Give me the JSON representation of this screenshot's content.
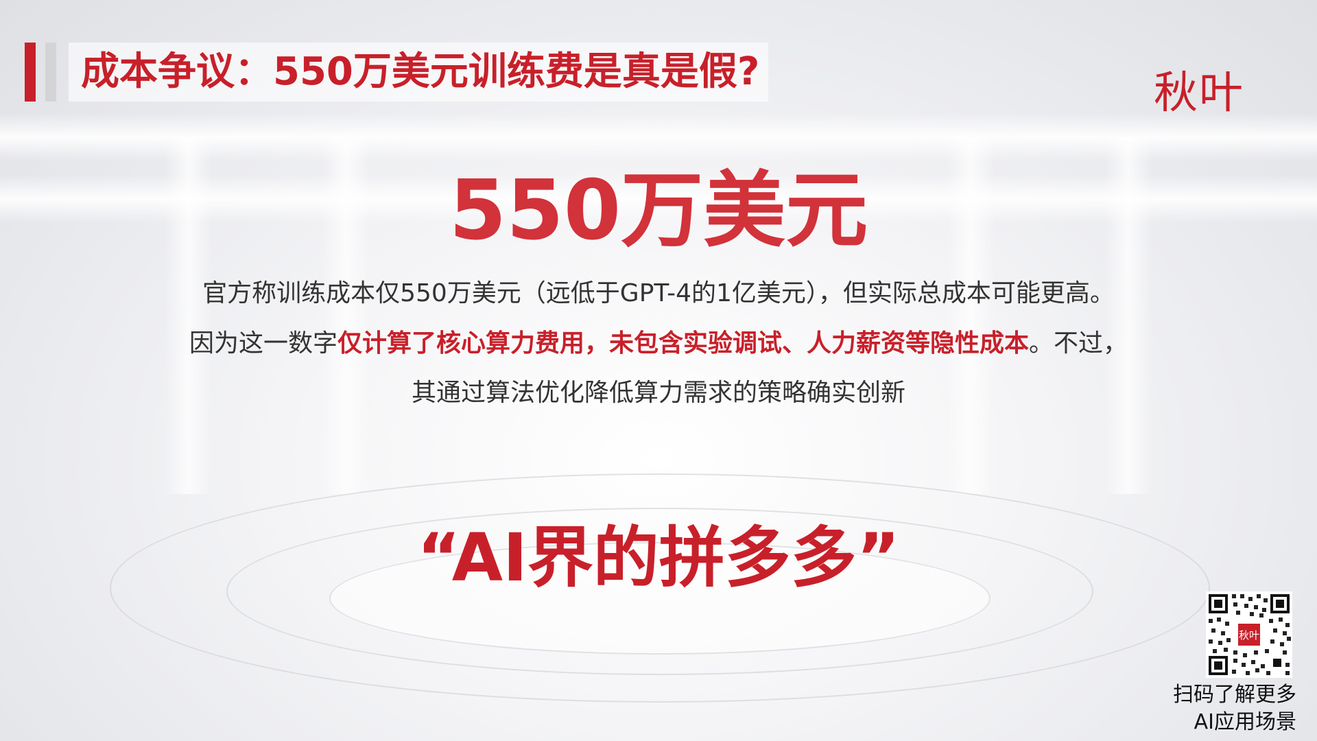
{
  "header": {
    "title": "成本争议：550万美元训练费是真是假?",
    "logo_text": "秋叶"
  },
  "main": {
    "headline_number": "550万美元",
    "paragraph": {
      "line1": "官方称训练成本仅550万美元（远低于GPT-4的1亿美元），但实际总成本可能更高。",
      "line2_prefix": "因为这一数字",
      "line2_highlight": "仅计算了核心算力费用，未包含实验调试、人力薪资等隐性成本",
      "line2_suffix": "。不过，",
      "line3": "其通过算法优化降低算力需求的策略确实创新"
    },
    "slogan": "“AI界的拼多多”"
  },
  "qr": {
    "center_label": "秋叶",
    "caption_line1": "扫码了解更多",
    "caption_line2": "AI应用场景"
  },
  "colors": {
    "accent_red": "#c8202a",
    "number_red": "#d2323a",
    "body_text": "#333333",
    "bar_gray": "#d4d4d6"
  }
}
